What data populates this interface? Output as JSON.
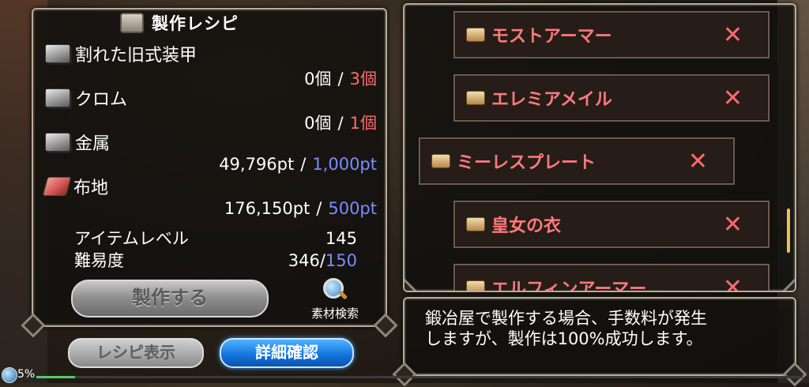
{
  "recipe_panel": {
    "title": "製作レシピ",
    "materials": [
      {
        "name": "割れた旧式装甲",
        "icon": "ingot-icon",
        "have": "0個",
        "need": "3個",
        "need_color": "red"
      },
      {
        "name": "クロム",
        "icon": "ingot-icon",
        "have": "0個",
        "need": "1個",
        "need_color": "red"
      },
      {
        "name": "金属",
        "icon": "ingot-icon",
        "have": "49,796pt",
        "need": "1,000pt",
        "need_color": "blue"
      },
      {
        "name": "布地",
        "icon": "cloth-icon",
        "have": "176,150pt",
        "need": "500pt",
        "need_color": "blue"
      }
    ],
    "item_level_label": "アイテムレベル",
    "item_level_value": "145",
    "difficulty_label": "難易度",
    "difficulty_have": "346",
    "difficulty_need": "150",
    "craft_button": "製作する",
    "material_search": "素材検索"
  },
  "buttons": {
    "recipe_view": "レシピ表示",
    "details": "詳細確認"
  },
  "recipe_list": [
    {
      "name": "モストアーマー",
      "mark": "✕"
    },
    {
      "name": "エレミアメイル",
      "mark": "✕"
    },
    {
      "name": "ミーレスプレート",
      "mark": "✕",
      "selected": true
    },
    {
      "name": "皇女の衣",
      "mark": "✕"
    },
    {
      "name": "エルフィンアーマー",
      "mark": "✕"
    }
  ],
  "description": {
    "line1": "鍛冶屋で製作する場合、手数料が発生",
    "line2": "しますが、製作は100%成功します。"
  },
  "status_bar": {
    "percent": "5%",
    "progress": 0.05
  },
  "colors": {
    "need_red": "#ff6b6b",
    "need_blue": "#7a8cff",
    "list_text": "#ff7a7a"
  }
}
